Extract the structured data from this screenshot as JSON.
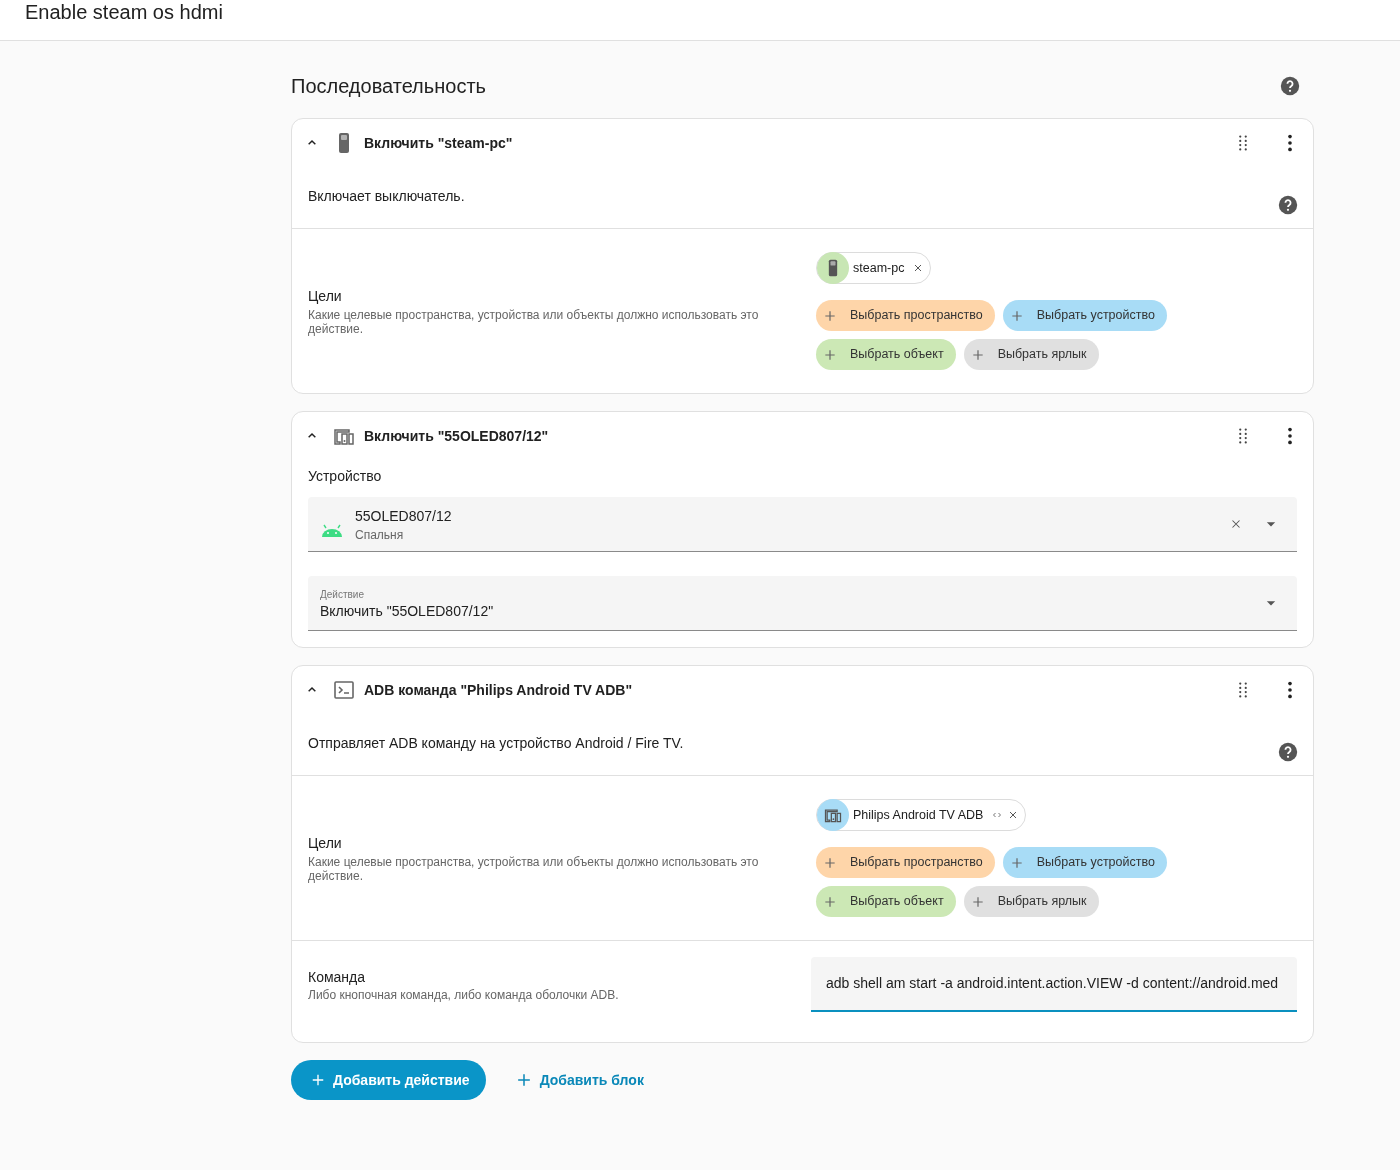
{
  "header": {
    "title": "Enable steam os hdmi"
  },
  "sequence": {
    "title": "Последовательность"
  },
  "actions": [
    {
      "kind": "service",
      "title": "Включить \"steam-pc\"",
      "expanded": true,
      "description": "Включает выключатель.",
      "targets": {
        "label": "Цели",
        "hint": "Какие целевые пространства, устройства или объекты должно использовать это действие.",
        "chips": [
          {
            "label": "steam-pc",
            "color": "#c8e6b4",
            "expandable": false
          }
        ],
        "pickers": [
          {
            "label": "Выбрать пространство",
            "color": "#fed5a9"
          },
          {
            "label": "Выбрать устройство",
            "color": "#a8dcf6"
          },
          {
            "label": "Выбрать объект",
            "color": "#cce8b5"
          },
          {
            "label": "Выбрать ярлык",
            "color": "#e0e0e0"
          }
        ]
      }
    },
    {
      "kind": "device",
      "title": "Включить \"55OLED807/12\"",
      "expanded": true,
      "device": {
        "label": "Устройство",
        "value": "55OLED807/12",
        "area": "Спальня"
      },
      "action": {
        "label": "Действие",
        "value": "Включить \"55OLED807/12\""
      }
    },
    {
      "kind": "service",
      "title": "ADB команда \"Philips Android TV ADB\"",
      "expanded": true,
      "description": "Отправляет ADB команду на устройство Android / Fire TV.",
      "targets": {
        "label": "Цели",
        "hint": "Какие целевые пространства, устройства или объекты должно использовать это действие.",
        "chips": [
          {
            "label": "Philips Android TV ADB",
            "color": "#a8dcf6",
            "expandable": true
          }
        ],
        "pickers": [
          {
            "label": "Выбрать пространство",
            "color": "#fed5a9"
          },
          {
            "label": "Выбрать устройство",
            "color": "#a8dcf6"
          },
          {
            "label": "Выбрать объект",
            "color": "#cce8b5"
          },
          {
            "label": "Выбрать ярлык",
            "color": "#e0e0e0"
          }
        ]
      },
      "field": {
        "label": "Команда",
        "hint": "Либо кнопочная команда, либо команда оболочки ADB.",
        "value": "adb shell am start -a android.intent.action.VIEW -d content://android.med"
      }
    }
  ],
  "buttons": {
    "add_action": "Добавить действие",
    "add_block": "Добавить блок"
  }
}
